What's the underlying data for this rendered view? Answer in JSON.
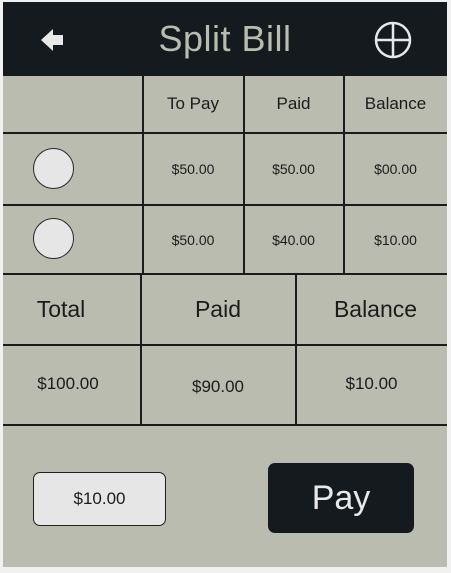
{
  "header": {
    "title": "Split Bill",
    "back_icon": "arrow-left-icon",
    "action_icon": "globe-icon"
  },
  "table": {
    "columns": [
      "To Pay",
      "Paid",
      "Balance"
    ],
    "rows": [
      {
        "to_pay": "$50.00",
        "paid": "$50.00",
        "balance": "$00.00"
      },
      {
        "to_pay": "$50.00",
        "paid": "$40.00",
        "balance": "$10.00"
      }
    ]
  },
  "summary": {
    "total_label": "Total",
    "paid_label": "Paid",
    "balance_label": "Balance",
    "total_value": "$100.00",
    "paid_value": "$90.00",
    "balance_value": "$10.00"
  },
  "footer": {
    "amount_value": "$10.00",
    "pay_label": "Pay"
  },
  "colors": {
    "background": "#b9bcaf",
    "header": "#141a1e",
    "accent_text": "#b9bcaf"
  }
}
